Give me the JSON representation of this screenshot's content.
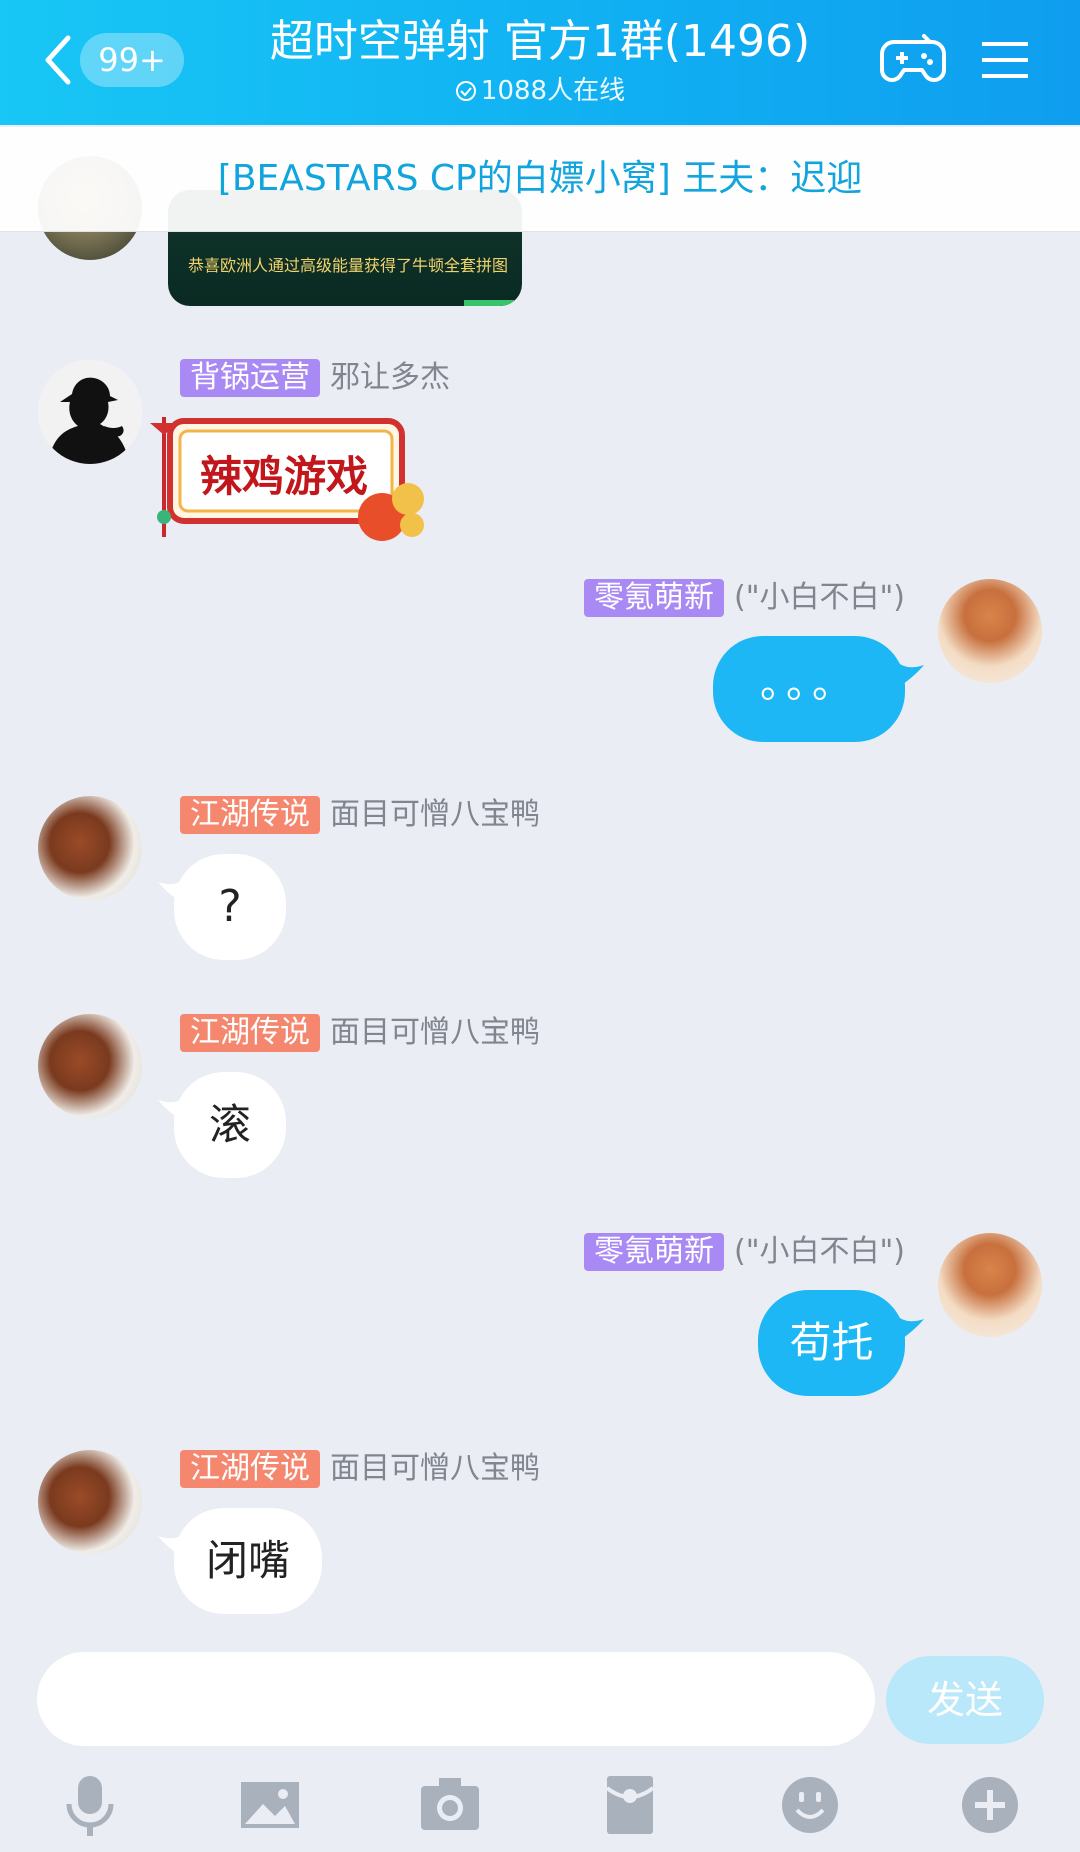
{
  "header": {
    "back_badge": "99+",
    "title": "超时空弹射 官方1群(1496)",
    "online": "1088人在线"
  },
  "notice": {
    "text": "[BEASTARS CP的白嫖小窝] 王夫：迟迎"
  },
  "messages": [
    {
      "side": "left",
      "tag": "背锅运营",
      "name": "邪让多杰",
      "sticker_text": "辣鸡游戏"
    },
    {
      "side": "right",
      "tag": "零氪萌新",
      "name": "(\"小白不白\")",
      "text": "。。。"
    },
    {
      "side": "left",
      "tag": "江湖传说",
      "name": "面目可憎八宝鸭",
      "text": "?"
    },
    {
      "side": "left",
      "tag": "江湖传说",
      "name": "面目可憎八宝鸭",
      "text": "滚"
    },
    {
      "side": "right",
      "tag": "零氪萌新",
      "name": "(\"小白不白\")",
      "text": "苟托"
    },
    {
      "side": "left",
      "tag": "江湖传说",
      "name": "面目可憎八宝鸭",
      "text": "闭嘴"
    }
  ],
  "partial_top": {
    "image_caption": "恭喜欧洲人通过高级能量获得了牛顿全套拼图"
  },
  "input": {
    "placeholder": "",
    "send_label": "发送"
  },
  "toolbar": [
    "microphone-icon",
    "image-icon",
    "camera-icon",
    "red-packet-icon",
    "emoji-icon",
    "plus-icon"
  ],
  "colors": {
    "header_start": "#18c7f5",
    "header_end": "#0f9eef",
    "bubble_blue": "#1db7f5",
    "tag_purple": "#a98af5",
    "tag_salmon": "#f5876e",
    "notice_text": "#12a5dd",
    "background": "#eaedf4"
  }
}
